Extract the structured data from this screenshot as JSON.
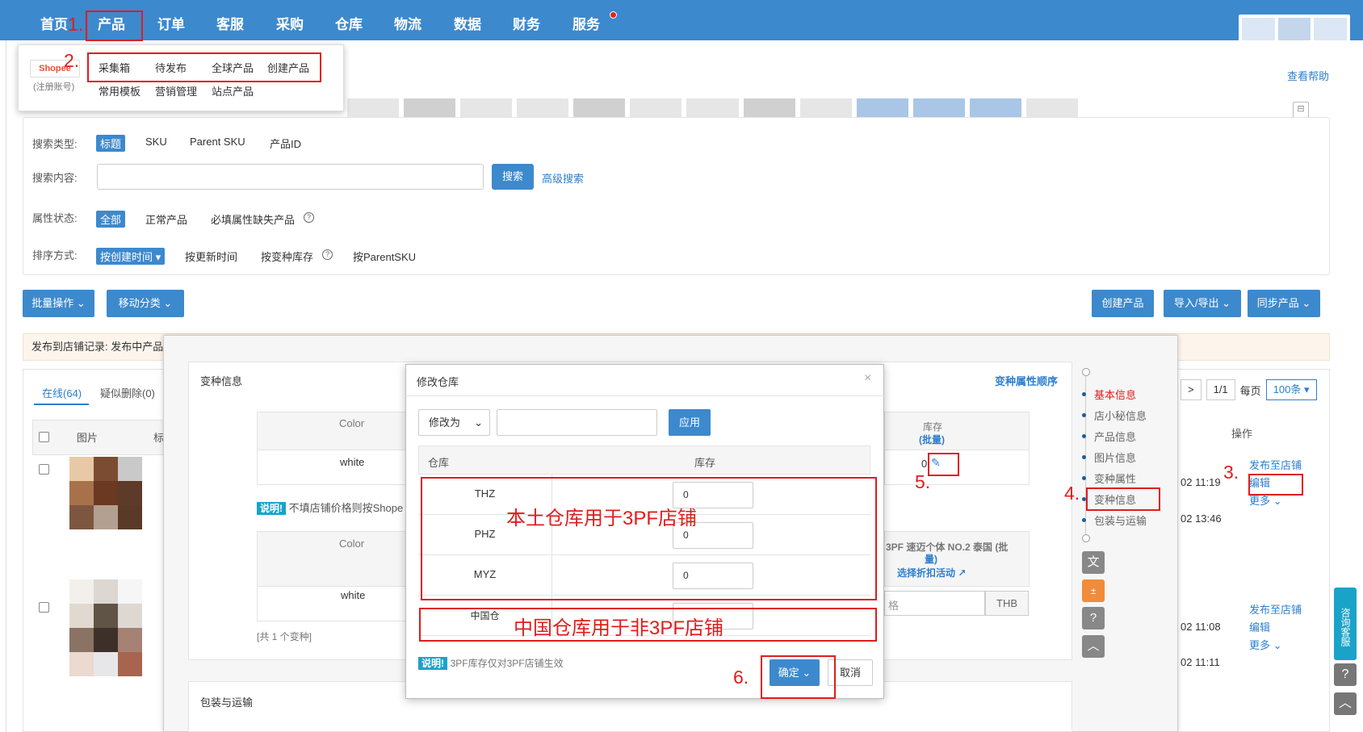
{
  "nav": {
    "items": [
      "首页",
      "产品",
      "订单",
      "客服",
      "采购",
      "仓库",
      "物流",
      "数据",
      "财务",
      "服务"
    ]
  },
  "dropdown": {
    "logo_text": "Shopee",
    "logo_sub": "(注册账号)",
    "row1": [
      "采集箱",
      "待发布",
      "全球产品",
      "创建产品"
    ],
    "row2": [
      "常用模板",
      "营销管理",
      "站点产品"
    ]
  },
  "help_link": "查看帮助",
  "search": {
    "type_label": "搜索类型:",
    "types": [
      "标题",
      "SKU",
      "Parent SKU",
      "产品ID"
    ],
    "content_label": "搜索内容:",
    "search_btn": "搜索",
    "advanced": "高级搜索",
    "status_label": "属性状态:",
    "statuses": [
      "全部",
      "正常产品",
      "必填属性缺失产品"
    ],
    "sort_label": "排序方式:",
    "sorts": [
      "按创建时间",
      "按更新时间",
      "按变种库存",
      "按ParentSKU"
    ]
  },
  "toolbar": {
    "batch": "批量操作",
    "move": "移动分类",
    "create": "创建产品",
    "import_export": "导入/导出",
    "sync": "同步产品"
  },
  "publish_record": "发布到店铺记录:  发布中产品",
  "tabs": {
    "online": "在线(64)",
    "suspected": "疑似删除(0)"
  },
  "table": {
    "col_image": "图片",
    "col_title": "标",
    "col_ops": "操作",
    "rows": [
      {
        "time1": "02 11:19",
        "time2": "02 13:46",
        "ops": [
          "发布至店铺",
          "编辑",
          "更多"
        ]
      },
      {
        "time1": "02 11:08",
        "time2": "02 11:11",
        "ops": [
          "发布至店铺",
          "编辑",
          "更多"
        ]
      }
    ]
  },
  "pagination": {
    "arrow": ">",
    "page": "1/1",
    "per_page_label": "每页",
    "per_page": "100条"
  },
  "side_widget": "咨询客服",
  "variant": {
    "title": "变种信息",
    "order_link": "变种属性顺序",
    "col_color": "Color",
    "value_white": "white",
    "col_stock": "库存",
    "col_stock_batch": "(批量)",
    "stock_value": "0",
    "note_tag": "说明!",
    "note_text": "不填店铺价格则按Shope",
    "col_3pf": "3PF 速迈个体 NO.2 泰国 (批",
    "col_3pf_2": "量)",
    "discount_link": "选择折扣活动",
    "price_placeholder": "格",
    "currency": "THB",
    "total": "[共 1 个变种]",
    "pack_title": "包装与运输"
  },
  "anchor_nav": [
    "基本信息",
    "店小秘信息",
    "产品信息",
    "图片信息",
    "变种属性",
    "变种信息",
    "包装与运输"
  ],
  "modal": {
    "title": "修改仓库",
    "modify_select": "修改为",
    "apply": "应用",
    "col_warehouse": "仓库",
    "col_stock": "库存",
    "warehouses": [
      {
        "name": "THZ",
        "stock": "0"
      },
      {
        "name": "PHZ",
        "stock": "0"
      },
      {
        "name": "MYZ",
        "stock": "0"
      },
      {
        "name": "中国仓",
        "stock": ""
      }
    ],
    "note_tag": "说明!",
    "note_text": "3PF库存仅对3PF店铺生效",
    "ok": "确定",
    "cancel": "取消"
  },
  "annotations": {
    "n1": "1.",
    "n2": "2.",
    "n3": "3.",
    "n4": "4.",
    "n5": "5.",
    "n6": "6.",
    "local_wh": "本土仓库用于3PF店铺",
    "china_wh": "中国仓库用于非3PF店铺"
  },
  "colors": {
    "primary": "#3d89cd",
    "annotation_red": "#e01c1c",
    "link": "#2c7fcf"
  }
}
